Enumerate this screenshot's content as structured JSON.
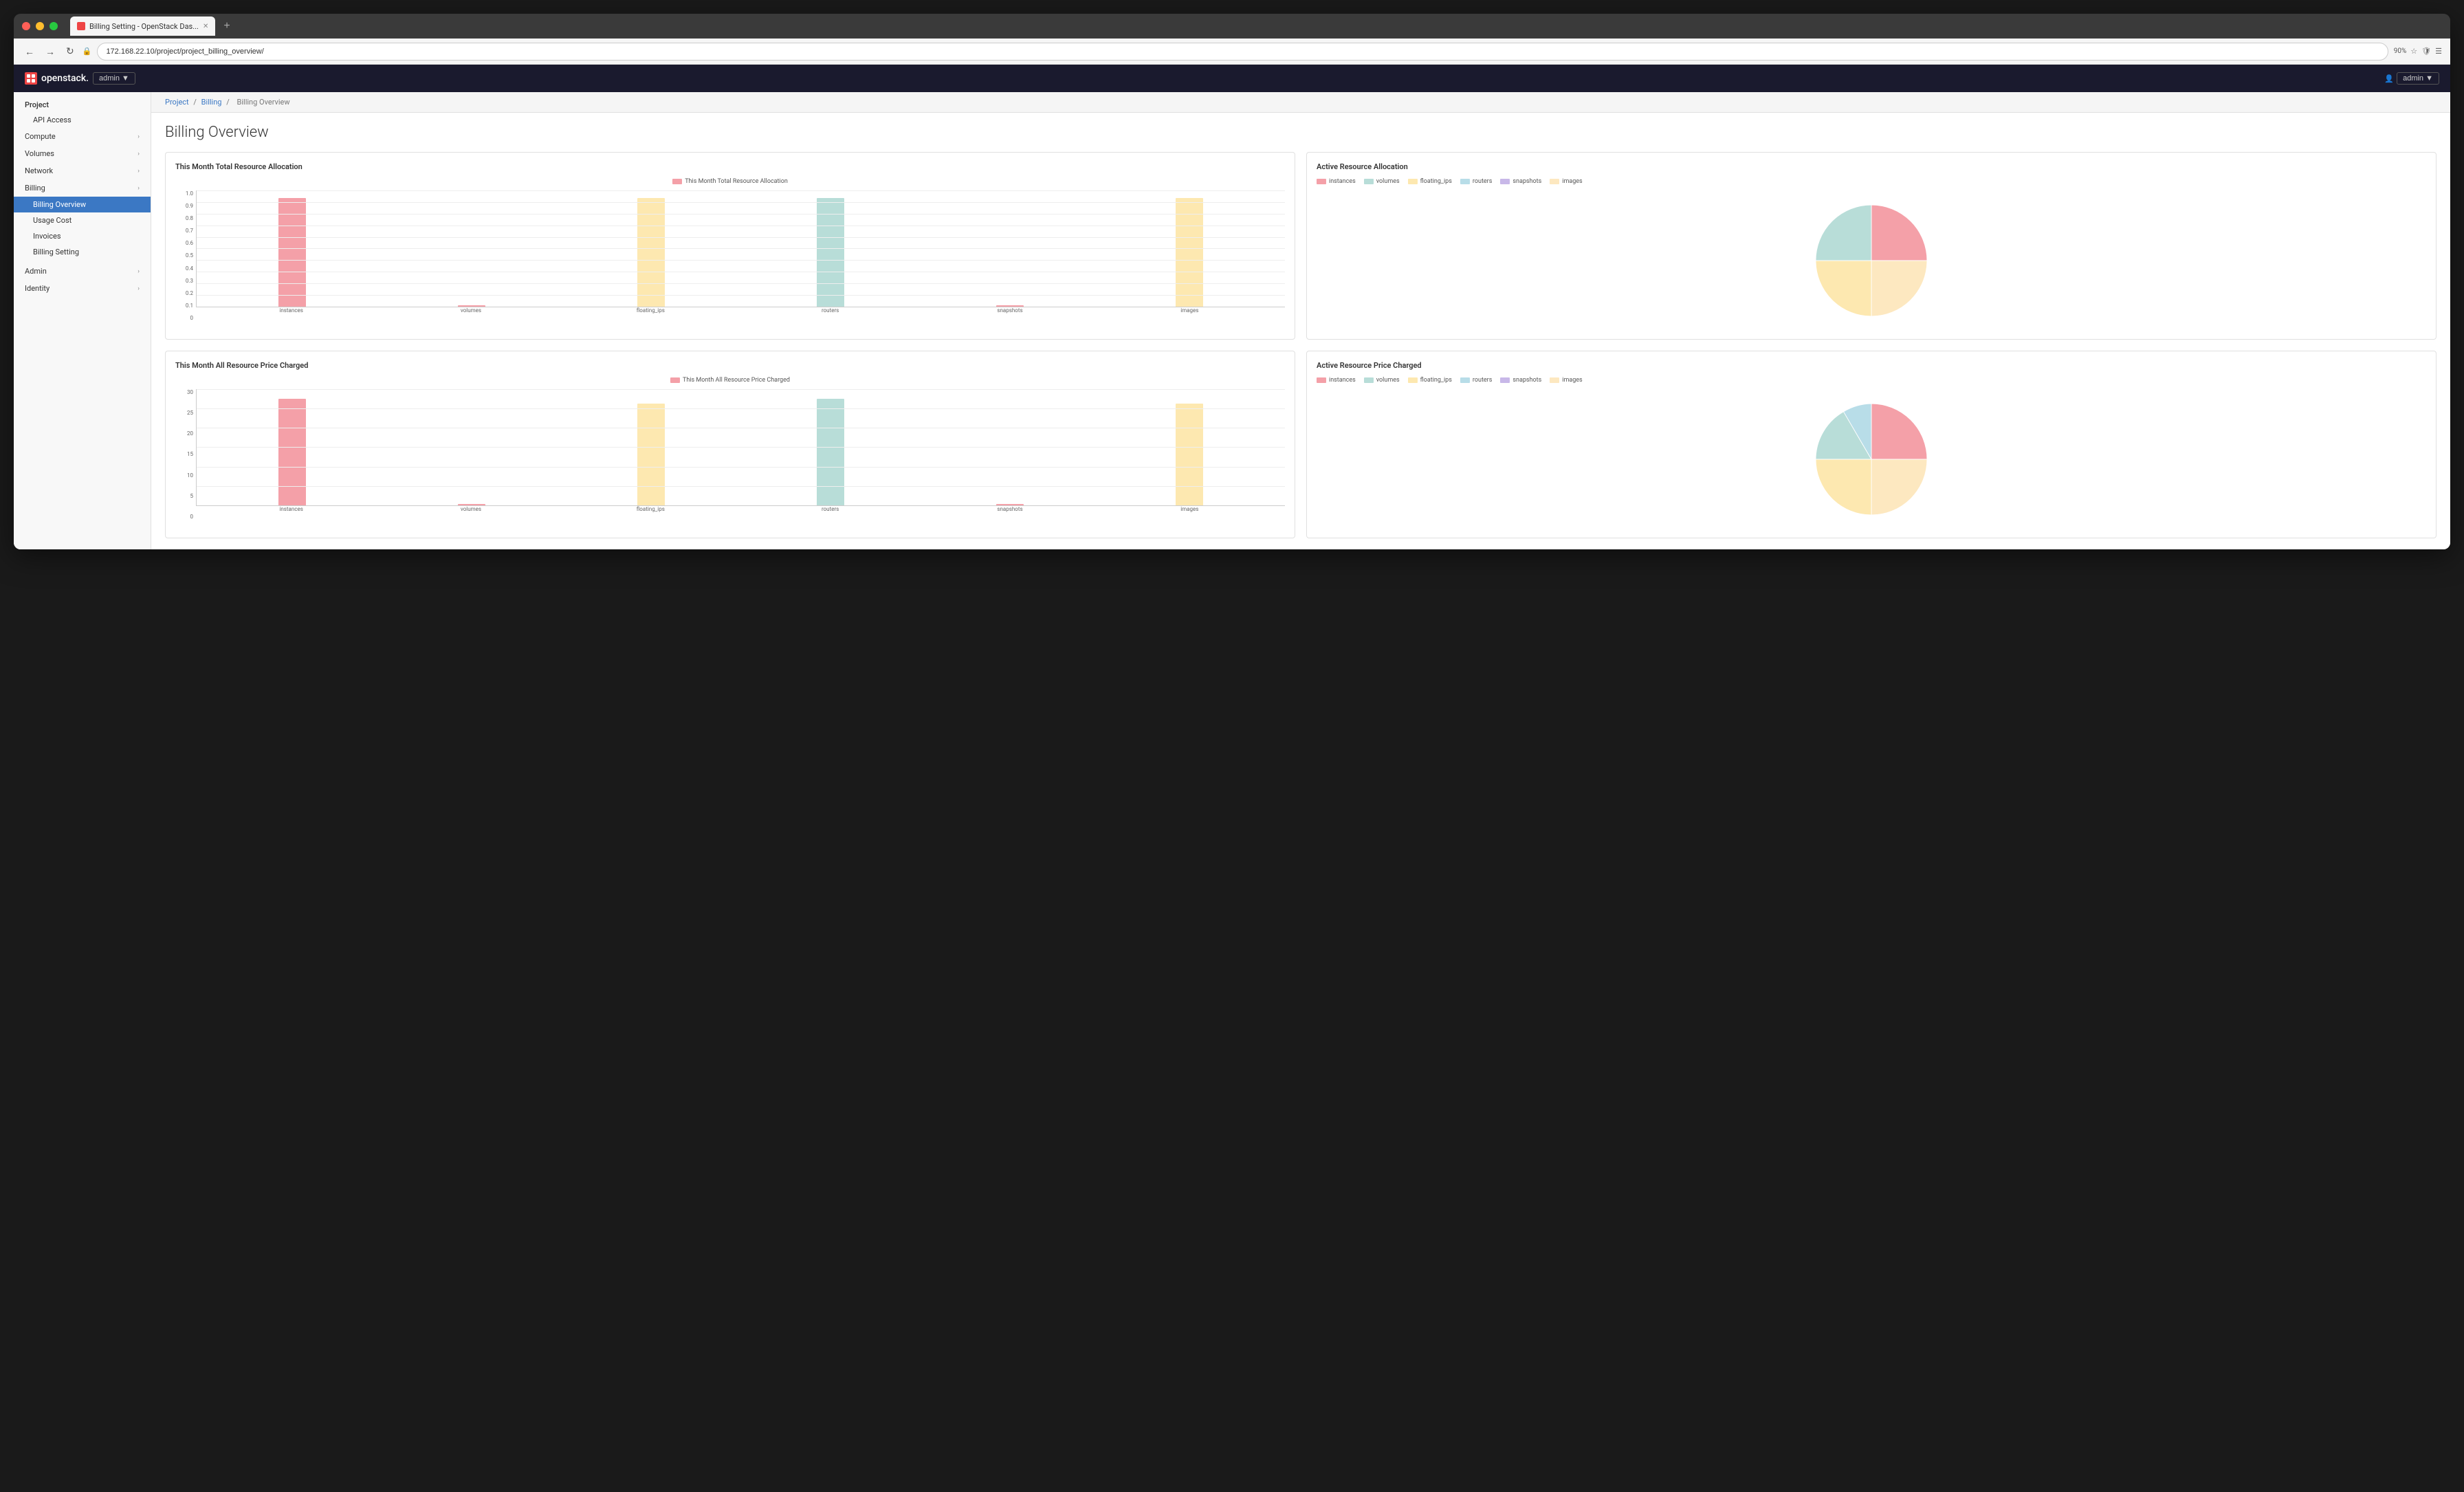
{
  "browser": {
    "tab_title": "Billing Setting - OpenStack Das...",
    "url": "172.168.22.10/project/project_billing_overview/",
    "zoom": "90%",
    "new_tab_label": "+"
  },
  "header": {
    "logo_text": "openstack.",
    "project_btn": "admin ▼",
    "user_btn": "admin ▼"
  },
  "breadcrumb": {
    "parts": [
      "Project",
      "Billing",
      "Billing Overview"
    ]
  },
  "page_title": "Billing Overview",
  "sidebar": {
    "project_label": "Project",
    "items": [
      {
        "label": "API Access",
        "type": "link",
        "indent": 1
      },
      {
        "label": "Compute",
        "type": "group",
        "chevron": "›"
      },
      {
        "label": "Volumes",
        "type": "group",
        "chevron": "›"
      },
      {
        "label": "Network",
        "type": "group",
        "chevron": "›"
      },
      {
        "label": "Billing",
        "type": "group",
        "chevron": "›",
        "expanded": true
      }
    ],
    "billing_sub": [
      {
        "label": "Billing Overview",
        "active": true
      },
      {
        "label": "Usage Cost"
      },
      {
        "label": "Invoices"
      },
      {
        "label": "Billing Setting"
      }
    ],
    "bottom_items": [
      {
        "label": "Admin",
        "chevron": "›"
      },
      {
        "label": "Identity",
        "chevron": "›"
      }
    ]
  },
  "chart1": {
    "title": "This Month Total Resource Allocation",
    "legend_label": "This Month Total Resource Allocation",
    "y_labels": [
      "1.0",
      "0.9",
      "0.8",
      "0.7",
      "0.6",
      "0.5",
      "0.4",
      "0.3",
      "0.2",
      "0.1",
      "0"
    ],
    "bars": [
      {
        "label": "instances",
        "height_pct": 97,
        "color": "#f4a0a8"
      },
      {
        "label": "volumes",
        "height_pct": 0,
        "color": "#f4a0a8"
      },
      {
        "label": "floating_ips",
        "height_pct": 97,
        "color": "#fde8b0"
      },
      {
        "label": "routers",
        "height_pct": 97,
        "color": "#b8ddd8"
      },
      {
        "label": "snapshots",
        "height_pct": 0,
        "color": "#f4a0a8"
      },
      {
        "label": "images",
        "height_pct": 97,
        "color": "#fde8b0"
      }
    ]
  },
  "chart2": {
    "title": "Active Resource Allocation",
    "legend": [
      {
        "label": "instances",
        "color": "#f4a0a8"
      },
      {
        "label": "volumes",
        "color": "#b8ddd8"
      },
      {
        "label": "floating_ips",
        "color": "#fde8b0"
      },
      {
        "label": "routers",
        "color": "#b8dde8"
      },
      {
        "label": "snapshots",
        "color": "#c8b8e8"
      },
      {
        "label": "images",
        "color": "#fde8b0"
      }
    ],
    "segments": [
      {
        "label": "instances",
        "color": "#f4a0a8",
        "percent": 25
      },
      {
        "label": "volumes",
        "color": "#b8ddd8",
        "percent": 25
      },
      {
        "label": "floating_ips",
        "color": "#fde8b0",
        "percent": 25
      },
      {
        "label": "images",
        "color": "#fde8c0",
        "percent": 25
      }
    ]
  },
  "chart3": {
    "title": "This Month All Resource Price Charged",
    "legend_label": "This Month All Resource Price Charged",
    "y_labels": [
      "30",
      "25",
      "20",
      "15",
      "10",
      "5",
      "0"
    ],
    "bars": [
      {
        "label": "instances",
        "height_pct": 97,
        "color": "#f4a0a8"
      },
      {
        "label": "volumes",
        "height_pct": 0,
        "color": "#f4a0a8"
      },
      {
        "label": "floating_ips",
        "height_pct": 95,
        "color": "#fde8b0"
      },
      {
        "label": "routers",
        "height_pct": 97,
        "color": "#b8ddd8"
      },
      {
        "label": "snapshots",
        "height_pct": 0,
        "color": "#f4a0a8"
      },
      {
        "label": "images",
        "height_pct": 95,
        "color": "#fde8b0"
      }
    ]
  },
  "chart4": {
    "title": "Active Resource Price Charged",
    "legend": [
      {
        "label": "instances",
        "color": "#f4a0a8"
      },
      {
        "label": "volumes",
        "color": "#b8ddd8"
      },
      {
        "label": "floating_ips",
        "color": "#fde8b0"
      },
      {
        "label": "routers",
        "color": "#b8dde8"
      },
      {
        "label": "snapshots",
        "color": "#c8b8e8"
      },
      {
        "label": "images",
        "color": "#fde8b0"
      }
    ]
  },
  "colors": {
    "instances": "#f4a0a8",
    "volumes": "#b8ddd8",
    "floating_ips": "#fde8b0",
    "routers": "#b8dde8",
    "snapshots": "#c8b8e8",
    "images": "#fde8c0",
    "active": "#3b78c4"
  }
}
